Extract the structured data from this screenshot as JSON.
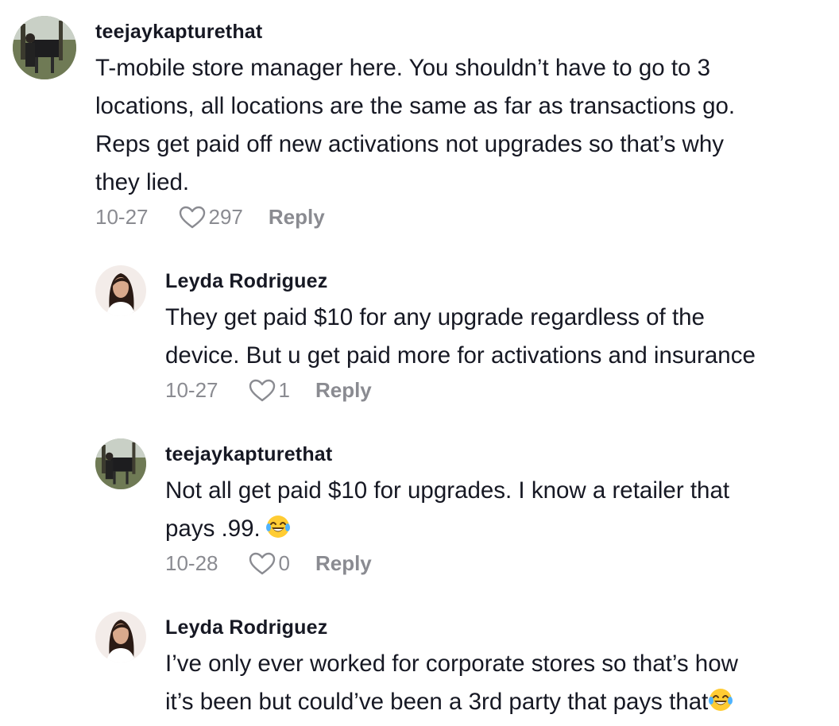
{
  "comments": [
    {
      "username": "teejaykapturethat",
      "lines": [
        "T-mobile store manager here. You shouldn’t have to go to 3",
        "locations, all locations are the same as far as transactions go.",
        "Reps get paid off new activations not upgrades so that’s why",
        "they lied."
      ],
      "date": "10-27",
      "likes": "297",
      "reply_label": "Reply",
      "avatar_icon": "profile-photo-outdoor"
    },
    {
      "username": "Leyda Rodriguez",
      "lines": [
        "They get paid $10 for any upgrade regardless of the",
        "device. But u get paid more for activations and insurance"
      ],
      "date": "10-27",
      "likes": "1",
      "reply_label": "Reply",
      "avatar_icon": "profile-photo-woman"
    },
    {
      "username": "teejaykapturethat",
      "lines": [
        "Not all get paid $10 for upgrades. I know a retailer that",
        "pays .99."
      ],
      "emoji": "face-with-tears-of-joy",
      "date": "10-28",
      "likes": "0",
      "reply_label": "Reply",
      "avatar_icon": "profile-photo-outdoor"
    },
    {
      "username": "Leyda Rodriguez",
      "lines": [
        "I’ve only ever worked for corporate stores so that’s how",
        "it’s been but could’ve been a 3rd party that pays that"
      ],
      "emoji": "face-with-tears-of-joy",
      "avatar_icon": "profile-photo-woman"
    }
  ],
  "colors": {
    "primary_text": "#161823",
    "secondary_text": "#8a8b91"
  }
}
